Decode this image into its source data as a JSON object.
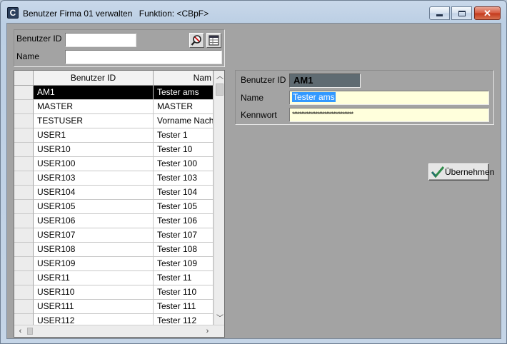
{
  "window": {
    "title": "Benutzer Firma 01 verwalten",
    "function_label": "Funktion: <CBpF>",
    "app_icon_glyph": "C"
  },
  "search": {
    "user_id_label": "Benutzer ID",
    "name_label": "Name",
    "user_id_value": "",
    "name_value": ""
  },
  "grid": {
    "columns": [
      "Benutzer ID",
      "Nam"
    ],
    "rows": [
      {
        "id": "AM1",
        "name": "Tester ams"
      },
      {
        "id": "MASTER",
        "name": "MASTER"
      },
      {
        "id": "TESTUSER",
        "name": "Vorname Nachname"
      },
      {
        "id": "USER1",
        "name": "Tester 1"
      },
      {
        "id": "USER10",
        "name": "Tester 10"
      },
      {
        "id": "USER100",
        "name": "Tester 100"
      },
      {
        "id": "USER103",
        "name": "Tester 103"
      },
      {
        "id": "USER104",
        "name": "Tester 104"
      },
      {
        "id": "USER105",
        "name": "Tester 105"
      },
      {
        "id": "USER106",
        "name": "Tester 106"
      },
      {
        "id": "USER107",
        "name": "Tester 107"
      },
      {
        "id": "USER108",
        "name": "Tester 108"
      },
      {
        "id": "USER109",
        "name": "Tester 109"
      },
      {
        "id": "USER11",
        "name": "Tester 11"
      },
      {
        "id": "USER110",
        "name": "Tester 110"
      },
      {
        "id": "USER111",
        "name": "Tester 111"
      },
      {
        "id": "USER112",
        "name": "Tester 112"
      }
    ],
    "selected_index": 0
  },
  "detail": {
    "user_id_label": "Benutzer ID",
    "user_id_value": "AM1",
    "name_label": "Name",
    "name_value": "Tester ams",
    "password_label": "Kennwort",
    "password_value": "**********************************"
  },
  "actions": {
    "apply_label": "Übernehmen"
  },
  "colors": {
    "client_bg": "#a3a3a3",
    "field_highlight": "#ffffdc",
    "selection": "#000000",
    "id_box": "#5f6b72"
  }
}
